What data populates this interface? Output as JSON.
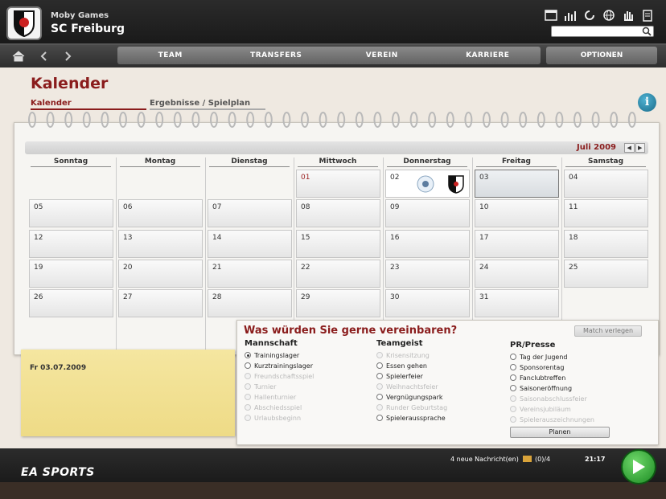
{
  "header": {
    "user_name": "Moby Games",
    "club_name": "SC Freiburg",
    "tool_icons": [
      "window-icon",
      "stats-icon",
      "refresh-icon",
      "globe-icon",
      "hand-icon",
      "document-icon"
    ],
    "search_placeholder": ""
  },
  "nav": {
    "tabs": [
      "TEAM",
      "TRANSFERS",
      "VEREIN",
      "KARRIERE"
    ],
    "options": "OPTIONEN"
  },
  "page": {
    "title": "Kalender",
    "subtabs": [
      "Kalender",
      "Ergebnisse / Spielplan"
    ]
  },
  "calendar": {
    "month": "Juli 2009",
    "weekdays": [
      "Sonntag",
      "Montag",
      "Dienstag",
      "Mittwoch",
      "Donnerstag",
      "Freitag",
      "Samstag"
    ],
    "days": [
      "01",
      "02",
      "03",
      "04",
      "05",
      "06",
      "07",
      "08",
      "09",
      "10",
      "11",
      "12",
      "13",
      "14",
      "15",
      "16",
      "17",
      "18",
      "19",
      "20",
      "21",
      "22",
      "23",
      "24",
      "25",
      "26",
      "27",
      "28",
      "29",
      "30",
      "31"
    ]
  },
  "note": {
    "date": "Fr 03.07.2009"
  },
  "arrange": {
    "title": "Was würden Sie gerne vereinbaren?",
    "match_verlegen": "Match verlegen",
    "planen": "Planen",
    "mannschaft": {
      "title": "Mannschaft",
      "options": [
        "Trainingslager",
        "Kurztrainingslager",
        "Freundschaftsspiel",
        "Turnier",
        "Hallenturnier",
        "Abschiedsspiel",
        "Urlaubsbeginn"
      ]
    },
    "teamgeist": {
      "title": "Teamgeist",
      "options": [
        "Krisensitzung",
        "Essen gehen",
        "Spielerfeier",
        "Weihnachtsfeier",
        "Vergnügungspark",
        "Runder Geburtstag",
        "Spieleraussprache"
      ]
    },
    "presse": {
      "title": "PR/Presse",
      "options": [
        "Tag der Jugend",
        "Sponsorentag",
        "Fanclubtreffen",
        "Saisoneröffnung",
        "Saisonabschlussfeier",
        "Vereinsjubiläum",
        "Spielerauszeichnungen"
      ]
    }
  },
  "footer": {
    "brand": "EA SPORTS",
    "news": "4 neue Nachricht(en)",
    "mail": "(0)/4",
    "time": "21:17"
  },
  "colors": {
    "accent": "#8a1c1c",
    "note": "#f2e193",
    "continue": "#2fa832"
  }
}
